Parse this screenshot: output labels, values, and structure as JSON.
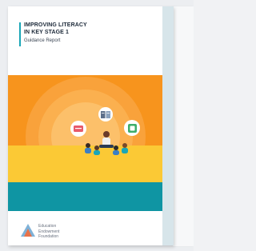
{
  "report": {
    "title_line1": "IMPROVING LITERACY",
    "title_line2": "IN KEY STAGE 1",
    "subtitle": "Guidance Report"
  },
  "publisher": {
    "line1": "Education",
    "line2": "Endowment",
    "line3": "Foundation"
  },
  "colors": {
    "accent_teal": "#0f95a3",
    "orange": "#f7941d",
    "yellow": "#fbc935"
  }
}
